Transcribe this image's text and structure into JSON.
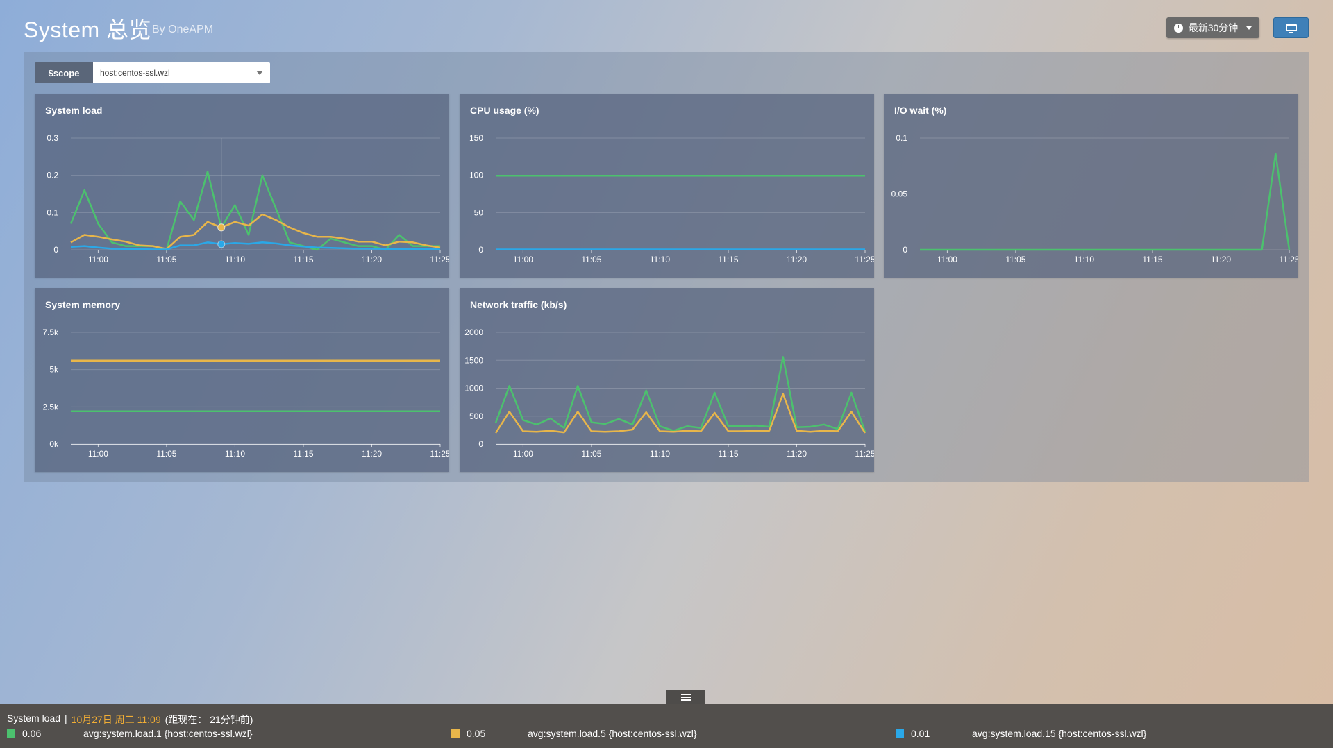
{
  "header": {
    "title": "System 总览",
    "subtitle": "By OneAPM",
    "time_range_label": "最新30分钟",
    "colors": {
      "accent": "#3f80b8"
    }
  },
  "scope": {
    "label": "$scope",
    "value": "host:centos-ssl.wzl"
  },
  "panels": {
    "system_load": {
      "title": "System load"
    },
    "cpu_usage": {
      "title": "CPU usage (%)"
    },
    "io_wait": {
      "title": "I/O wait (%)"
    },
    "system_memory": {
      "title": "System memory"
    },
    "network_traffic": {
      "title": "Network traffic (kb/s)"
    }
  },
  "chart_data": [
    {
      "type": "line",
      "title": "System load",
      "x_ticks": [
        "11:00",
        "11:05",
        "11:10",
        "11:15",
        "11:20",
        "11:25"
      ],
      "y_ticks": [
        "0",
        "0.1",
        "0.2",
        "0.3"
      ],
      "ylim": [
        0,
        0.3
      ],
      "x": [
        "10:58",
        "10:59",
        "11:00",
        "11:01",
        "11:02",
        "11:03",
        "11:04",
        "11:05",
        "11:06",
        "11:07",
        "11:08",
        "11:09",
        "11:10",
        "11:11",
        "11:12",
        "11:13",
        "11:14",
        "11:15",
        "11:16",
        "11:17",
        "11:18",
        "11:19",
        "11:20",
        "11:21",
        "11:22",
        "11:23",
        "11:24",
        "11:25"
      ],
      "series": [
        {
          "color": "#4cc16e",
          "values": [
            0.07,
            0.16,
            0.07,
            0.02,
            0.01,
            0.01,
            0.01,
            0.0,
            0.13,
            0.08,
            0.21,
            0.06,
            0.12,
            0.04,
            0.2,
            0.11,
            0.02,
            0.01,
            0.0,
            0.03,
            0.02,
            0.01,
            0.01,
            0.0,
            0.04,
            0.01,
            0.01,
            0.01
          ]
        },
        {
          "color": "#e8b64a",
          "values": [
            0.02,
            0.04,
            0.035,
            0.028,
            0.022,
            0.012,
            0.01,
            0.002,
            0.035,
            0.04,
            0.075,
            0.06,
            0.075,
            0.065,
            0.095,
            0.08,
            0.06,
            0.045,
            0.035,
            0.035,
            0.03,
            0.022,
            0.022,
            0.012,
            0.022,
            0.02,
            0.012,
            0.006
          ]
        },
        {
          "color": "#2aa8e8",
          "values": [
            0.008,
            0.01,
            0.006,
            0.003,
            0.002,
            0.002,
            0.001,
            0.001,
            0.012,
            0.012,
            0.02,
            0.015,
            0.018,
            0.016,
            0.02,
            0.017,
            0.012,
            0.009,
            0.006,
            0.005,
            0.004,
            0.003,
            0.003,
            0.002,
            0.002,
            0.002,
            0.002,
            0.001
          ]
        }
      ],
      "hover_x": "11:09"
    },
    {
      "type": "line",
      "title": "CPU usage (%)",
      "x_ticks": [
        "11:00",
        "11:05",
        "11:10",
        "11:15",
        "11:20",
        "11:25"
      ],
      "y_ticks": [
        "0",
        "50",
        "100",
        "150"
      ],
      "ylim": [
        0,
        150
      ],
      "x": [
        "10:58",
        "11:25"
      ],
      "series": [
        {
          "color": "#4cc16e",
          "values": [
            99.5,
            99.5
          ]
        },
        {
          "color": "#2aa8e8",
          "values": [
            0.5,
            0.5
          ]
        }
      ]
    },
    {
      "type": "line",
      "title": "I/O wait (%)",
      "x_ticks": [
        "11:00",
        "11:05",
        "11:10",
        "11:15",
        "11:20",
        "11:25"
      ],
      "y_ticks": [
        "0",
        "0.05",
        "0.1"
      ],
      "ylim": [
        0,
        0.1
      ],
      "x": [
        "10:58",
        "11:23",
        "11:24",
        "11:25"
      ],
      "series": [
        {
          "color": "#4cc16e",
          "values": [
            0,
            0,
            0.086,
            0
          ]
        }
      ]
    },
    {
      "type": "line",
      "title": "System memory",
      "x_ticks": [
        "11:00",
        "11:05",
        "11:10",
        "11:15",
        "11:20",
        "11:25"
      ],
      "y_ticks": [
        "0k",
        "2.5k",
        "5k",
        "7.5k"
      ],
      "ylim": [
        0,
        7500
      ],
      "x": [
        "10:58",
        "11:25"
      ],
      "series": [
        {
          "color": "#e8b64a",
          "values": [
            5600,
            5600
          ]
        },
        {
          "color": "#4cc16e",
          "values": [
            2200,
            2200
          ]
        }
      ]
    },
    {
      "type": "line",
      "title": "Network traffic (kb/s)",
      "x_ticks": [
        "11:00",
        "11:05",
        "11:10",
        "11:15",
        "11:20",
        "11:25"
      ],
      "y_ticks": [
        "0",
        "500",
        "1000",
        "1500",
        "2000"
      ],
      "ylim": [
        0,
        2000
      ],
      "x": [
        "10:58",
        "10:59",
        "11:00",
        "11:01",
        "11:02",
        "11:03",
        "11:04",
        "11:05",
        "11:06",
        "11:07",
        "11:08",
        "11:09",
        "11:10",
        "11:11",
        "11:12",
        "11:13",
        "11:14",
        "11:15",
        "11:16",
        "11:17",
        "11:18",
        "11:19",
        "11:20",
        "11:21",
        "11:22",
        "11:23",
        "11:24",
        "11:25"
      ],
      "series": [
        {
          "color": "#4cc16e",
          "values": [
            380,
            1040,
            430,
            350,
            460,
            290,
            1040,
            390,
            360,
            450,
            350,
            960,
            320,
            240,
            320,
            290,
            920,
            320,
            320,
            330,
            310,
            1560,
            300,
            310,
            350,
            270,
            920,
            220
          ]
        },
        {
          "color": "#e8b64a",
          "values": [
            200,
            580,
            230,
            220,
            240,
            210,
            580,
            230,
            220,
            230,
            260,
            570,
            230,
            220,
            240,
            230,
            560,
            230,
            230,
            240,
            240,
            900,
            240,
            220,
            240,
            230,
            580,
            200
          ]
        }
      ]
    }
  ],
  "footer": {
    "panel_name": "System load",
    "separator": "|",
    "date": "10月27日 周二 11:09",
    "relative": "(距现在： 21分钟前)",
    "legend": [
      {
        "color": "#4cc16e",
        "value": "0.06",
        "label": "avg:system.load.1  {host:centos-ssl.wzl}"
      },
      {
        "color": "#e8b64a",
        "value": "0.05",
        "label": "avg:system.load.5  {host:centos-ssl.wzl}"
      },
      {
        "color": "#2aa8e8",
        "value": "0.01",
        "label": "avg:system.load.15  {host:centos-ssl.wzl}"
      }
    ]
  }
}
